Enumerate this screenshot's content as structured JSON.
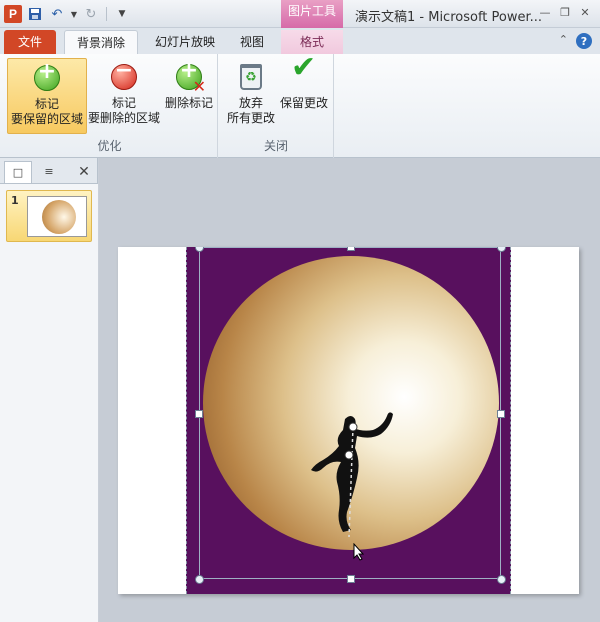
{
  "title_bar": {
    "app_icon_letter": "P",
    "context_tool_title": "图片工具",
    "window_title": "演示文稿1 - Microsoft Power..."
  },
  "tabs": {
    "file": "文件",
    "background_removal": "背景消除",
    "slideshow": "幻灯片放映",
    "view": "视图",
    "format": "格式"
  },
  "ribbon": {
    "groups": {
      "optimize": "优化",
      "close": "关闭"
    },
    "buttons": {
      "mark_keep_line1": "标记",
      "mark_keep_line2": "要保留的区域",
      "mark_remove_line1": "标记",
      "mark_remove_line2": "要删除的区域",
      "delete_mark": "删除标记",
      "discard_line1": "放弃",
      "discard_line2": "所有更改",
      "keep_changes": "保留更改"
    }
  },
  "slides_panel": {
    "slide_number": "1"
  },
  "colors": {
    "file_tab": "#d24726",
    "context_tab": "#d66aa8",
    "photo_background": "#58105e",
    "selected_button": "#f7c960"
  },
  "icons": {
    "save": "save-icon",
    "undo": "undo-icon",
    "redo": "redo-icon",
    "mark_keep": "plus-circle-icon",
    "mark_remove": "minus-circle-icon",
    "delete_mark": "delete-mark-icon",
    "discard": "recycle-bin-icon",
    "keep": "checkmark-icon"
  }
}
